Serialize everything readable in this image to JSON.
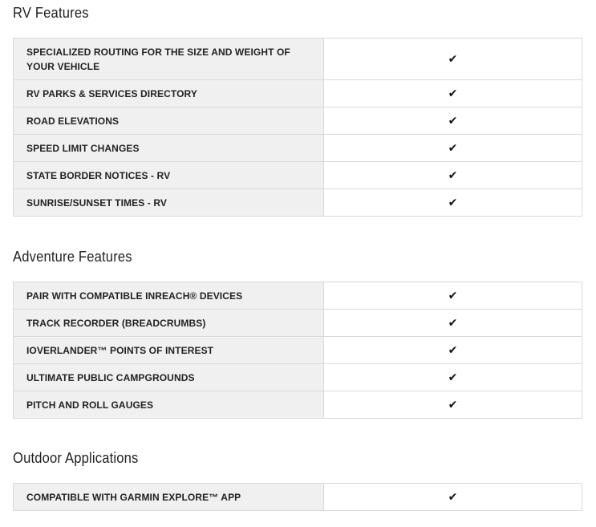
{
  "sections": [
    {
      "title": "RV Features",
      "rows": [
        {
          "label": "SPECIALIZED ROUTING FOR THE SIZE AND WEIGHT OF YOUR VEHICLE",
          "value": "✔"
        },
        {
          "label": "RV PARKS & SERVICES DIRECTORY",
          "value": "✔"
        },
        {
          "label": "ROAD ELEVATIONS",
          "value": "✔"
        },
        {
          "label": "SPEED LIMIT CHANGES",
          "value": "✔"
        },
        {
          "label": "STATE BORDER NOTICES - RV",
          "value": "✔"
        },
        {
          "label": "SUNRISE/SUNSET TIMES - RV",
          "value": "✔"
        }
      ]
    },
    {
      "title": "Adventure Features",
      "rows": [
        {
          "label": "PAIR WITH COMPATIBLE INREACH® DEVICES",
          "value": "✔"
        },
        {
          "label": "TRACK RECORDER (BREADCRUMBS)",
          "value": "✔"
        },
        {
          "label": "IOVERLANDER™ POINTS OF INTEREST",
          "value": "✔"
        },
        {
          "label": "ULTIMATE PUBLIC CAMPGROUNDS",
          "value": "✔"
        },
        {
          "label": "PITCH AND ROLL GAUGES",
          "value": "✔"
        }
      ]
    },
    {
      "title": "Outdoor Applications",
      "rows": [
        {
          "label": "COMPATIBLE WITH GARMIN EXPLORE™ APP",
          "value": "✔"
        }
      ]
    }
  ],
  "icons": {
    "check": "checkmark-icon"
  }
}
